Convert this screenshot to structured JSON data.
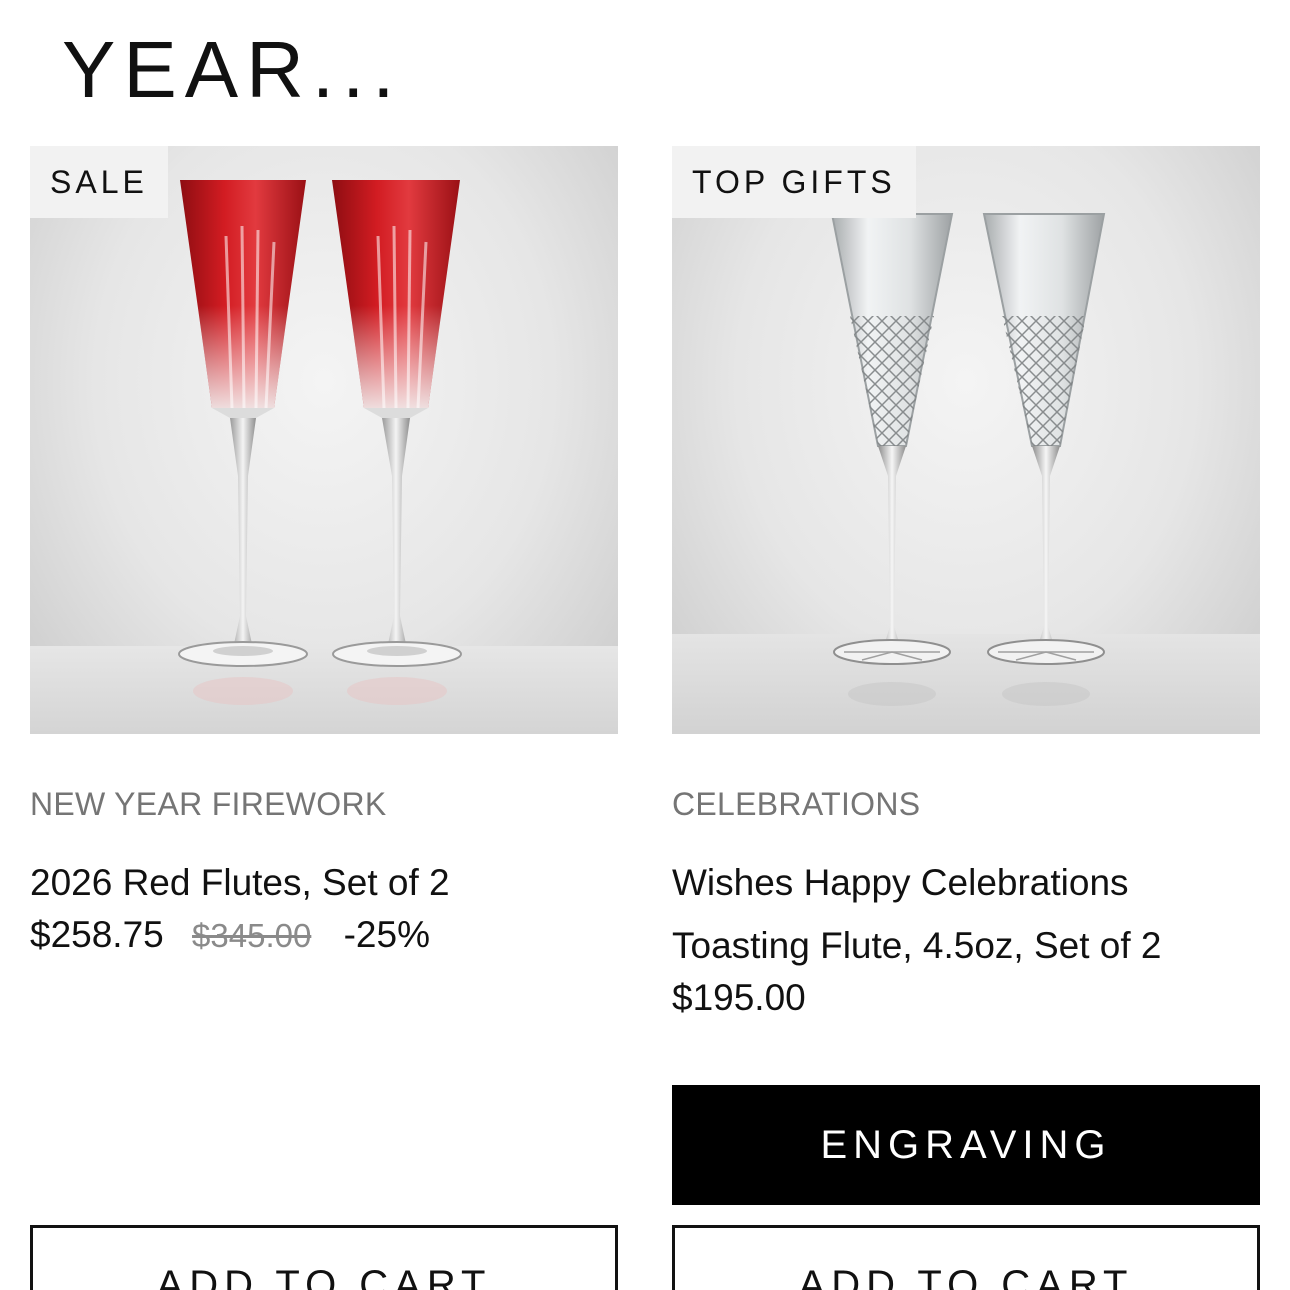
{
  "section": {
    "title": "YEAR..."
  },
  "products": [
    {
      "badge": "SALE",
      "collection": "NEW YEAR FIREWORK",
      "name": "2026 Red Flutes, Set of 2",
      "price": "$258.75",
      "original_price": "$345.00",
      "discount": "-25%",
      "add_to_cart_label": "ADD TO CART",
      "glass_color": "#c8161d"
    },
    {
      "badge": "TOP GIFTS",
      "collection": "CELEBRATIONS",
      "name": "Wishes Happy Celebrations Toasting Flute, 4.5oz, Set of 2",
      "price": "$195.00",
      "engraving_label": "ENGRAVING",
      "add_to_cart_label": "ADD TO CART",
      "glass_color": "#e9ecee"
    }
  ]
}
